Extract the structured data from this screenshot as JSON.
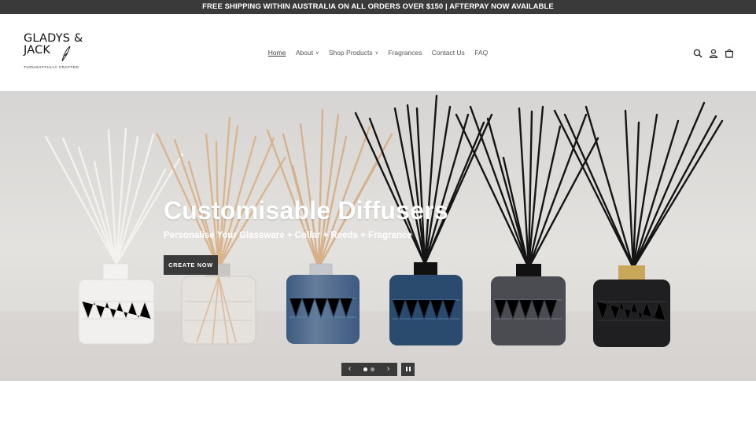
{
  "announcement": {
    "text": "FREE SHIPPING WITHIN AUSTRALIA ON ALL ORDERS OVER $150 | AFTERPAY NOW AVAILABLE"
  },
  "logo": {
    "line1": "GLADYS &",
    "line2": "JACK",
    "tagline": "THOUGHTFULLY CRAFTED"
  },
  "nav": {
    "items": [
      {
        "label": "Home",
        "active": true,
        "dropdown": false
      },
      {
        "label": "About",
        "active": false,
        "dropdown": true
      },
      {
        "label": "Shop Products",
        "active": false,
        "dropdown": true
      },
      {
        "label": "Fragrances",
        "active": false,
        "dropdown": false
      },
      {
        "label": "Contact Us",
        "active": false,
        "dropdown": false
      },
      {
        "label": "FAQ",
        "active": false,
        "dropdown": false
      }
    ]
  },
  "header_icons": [
    "search-icon",
    "account-icon",
    "cart-icon"
  ],
  "hero": {
    "title": "Customisable Diffusers",
    "subtitle": "Personalise Your Glassware + Collar + Reeds + Fragrance",
    "button_label": "CREATE NOW"
  },
  "slider": {
    "slide_count": 2,
    "active_index": 0,
    "prev_icon": "chevron-left-icon",
    "next_icon": "chevron-right-icon",
    "pause_icon": "pause-icon"
  },
  "colors": {
    "announcement_bg": "#3a3a3a",
    "button_bg": "#3a3a3a",
    "hero_text": "#ffffff"
  }
}
